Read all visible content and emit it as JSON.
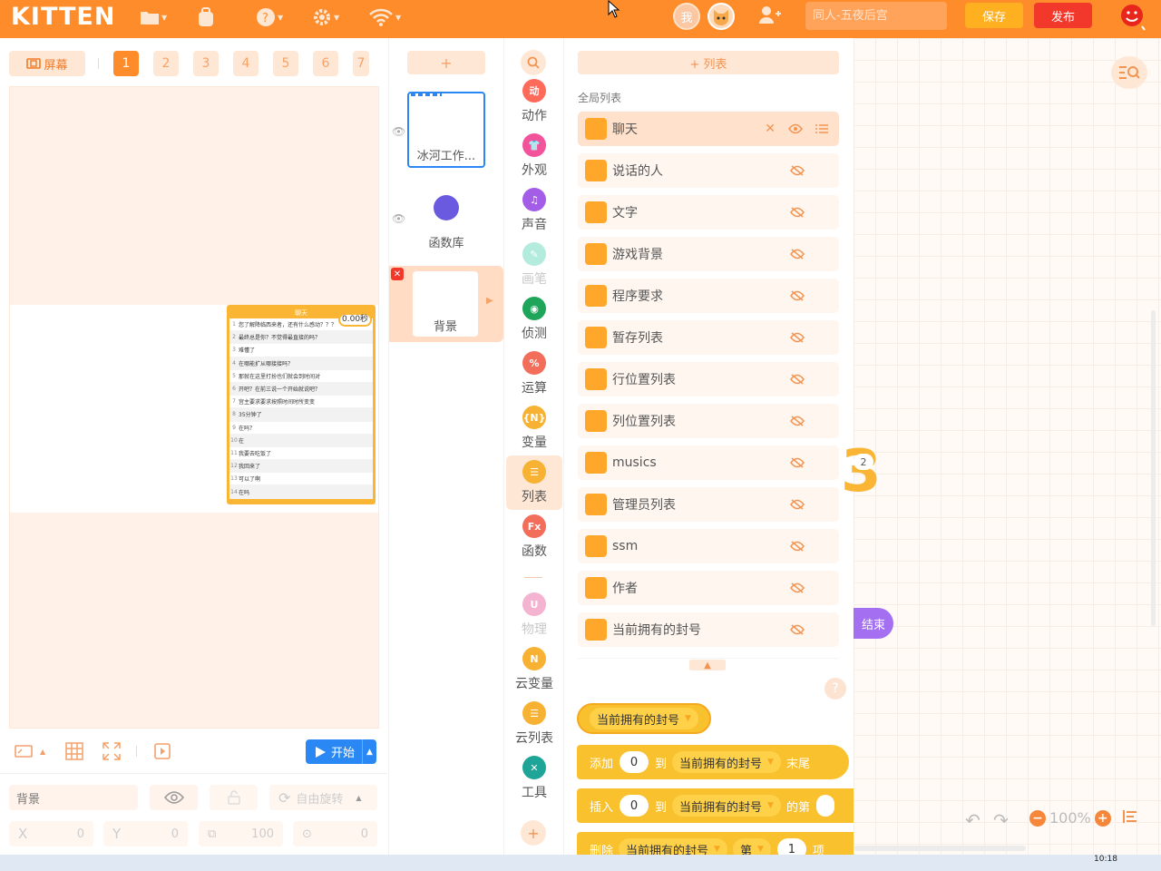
{
  "topbar": {
    "logo": "KITTEN",
    "me_avatar": "我",
    "title_placeholder": "同人-五夜后宫",
    "save_label": "保存",
    "publish_label": "发布"
  },
  "left": {
    "screen_label": "屏幕",
    "tabs": [
      "1",
      "2",
      "3",
      "4",
      "5",
      "6",
      "7"
    ],
    "active_tab": "1",
    "list_widget": {
      "title": "聊天",
      "timer": "0.00秒",
      "rows": [
        {
          "idx": "1",
          "text": "您了解降临西来者，还有什么感动？？？"
        },
        {
          "idx": "2",
          "text": "最终总是你？不觉得最直接的吗？"
        },
        {
          "idx": "3",
          "text": "难懂了"
        },
        {
          "idx": "4",
          "text": "在哪能扩从哪接接吗？"
        },
        {
          "idx": "5",
          "text": "那就在这里打扮也们就会到时间对"
        },
        {
          "idx": "6",
          "text": "开吧？在前三说一个开始就说吧？"
        },
        {
          "idx": "7",
          "text": "宫主要求要求按照时间时所变变"
        },
        {
          "idx": "8",
          "text": "35分钟了"
        },
        {
          "idx": "9",
          "text": "在吗？"
        },
        {
          "idx": "10",
          "text": "在"
        },
        {
          "idx": "11",
          "text": "我要去吃饭了"
        },
        {
          "idx": "12",
          "text": "我回来了"
        },
        {
          "idx": "13",
          "text": "可以了啊"
        },
        {
          "idx": "14",
          "text": "在吗"
        }
      ]
    },
    "start_label": "开始",
    "prop": {
      "name": "背景",
      "rotate_label": "自由旋转",
      "x_label": "X",
      "x_value": "0",
      "y_label": "Y",
      "y_value": "0",
      "size_value": "100",
      "dir_value": "0"
    }
  },
  "sprites": {
    "add": "+",
    "items": [
      {
        "name": "冰河工作..."
      },
      {
        "name": "函数库"
      }
    ],
    "background": "背景"
  },
  "categories": [
    {
      "label": "动作",
      "color": "#ff6b5b",
      "icon": "动"
    },
    {
      "label": "外观",
      "color": "#f2539a",
      "icon": "👕"
    },
    {
      "label": "声音",
      "color": "#a45de7",
      "icon": "♫"
    },
    {
      "label": "画笔",
      "color": "#b3ecdd",
      "icon": "✎"
    },
    {
      "label": "侦测",
      "color": "#1fa55a",
      "icon": "◉"
    },
    {
      "label": "运算",
      "color": "#f26d5a",
      "icon": "%"
    },
    {
      "label": "变量",
      "color": "#f7b233",
      "icon": "{N}"
    },
    {
      "label": "列表",
      "color": "#f7b233",
      "icon": "☰"
    },
    {
      "label": "函数",
      "color": "#f26d5a",
      "icon": "Fx"
    },
    {
      "label": "物理",
      "color": "#f3b3d1",
      "icon": "U"
    },
    {
      "label": "云变量",
      "color": "#f7b233",
      "icon": "N"
    },
    {
      "label": "云列表",
      "color": "#f7b233",
      "icon": "☰"
    },
    {
      "label": "工具",
      "color": "#1fa598",
      "icon": "✕"
    }
  ],
  "listpanel": {
    "new_list": "+ 列表",
    "global_label": "全局列表",
    "lists": [
      "聊天",
      "说话的人",
      "文字",
      "游戏背景",
      "程序要求",
      "暂存列表",
      "行位置列表",
      "列位置列表",
      "musics",
      "管理员列表",
      "ssm",
      "作者",
      "当前拥有的封号"
    ],
    "blocks": {
      "reporter": "当前拥有的封号",
      "add": {
        "a": "添加",
        "v": "0",
        "b": "到",
        "list": "当前拥有的封号",
        "c": "末尾"
      },
      "insert": {
        "a": "插入",
        "v": "0",
        "b": "到",
        "list": "当前拥有的封号",
        "c": "的第"
      },
      "delete": {
        "a": "删除",
        "list": "当前拥有的封号",
        "b": "第",
        "v": "1",
        "c": "项"
      }
    }
  },
  "workspace": {
    "end_label": "结束",
    "zoom": "100%",
    "num_badge": "2"
  },
  "taskbar": {
    "clock": "10:18"
  }
}
